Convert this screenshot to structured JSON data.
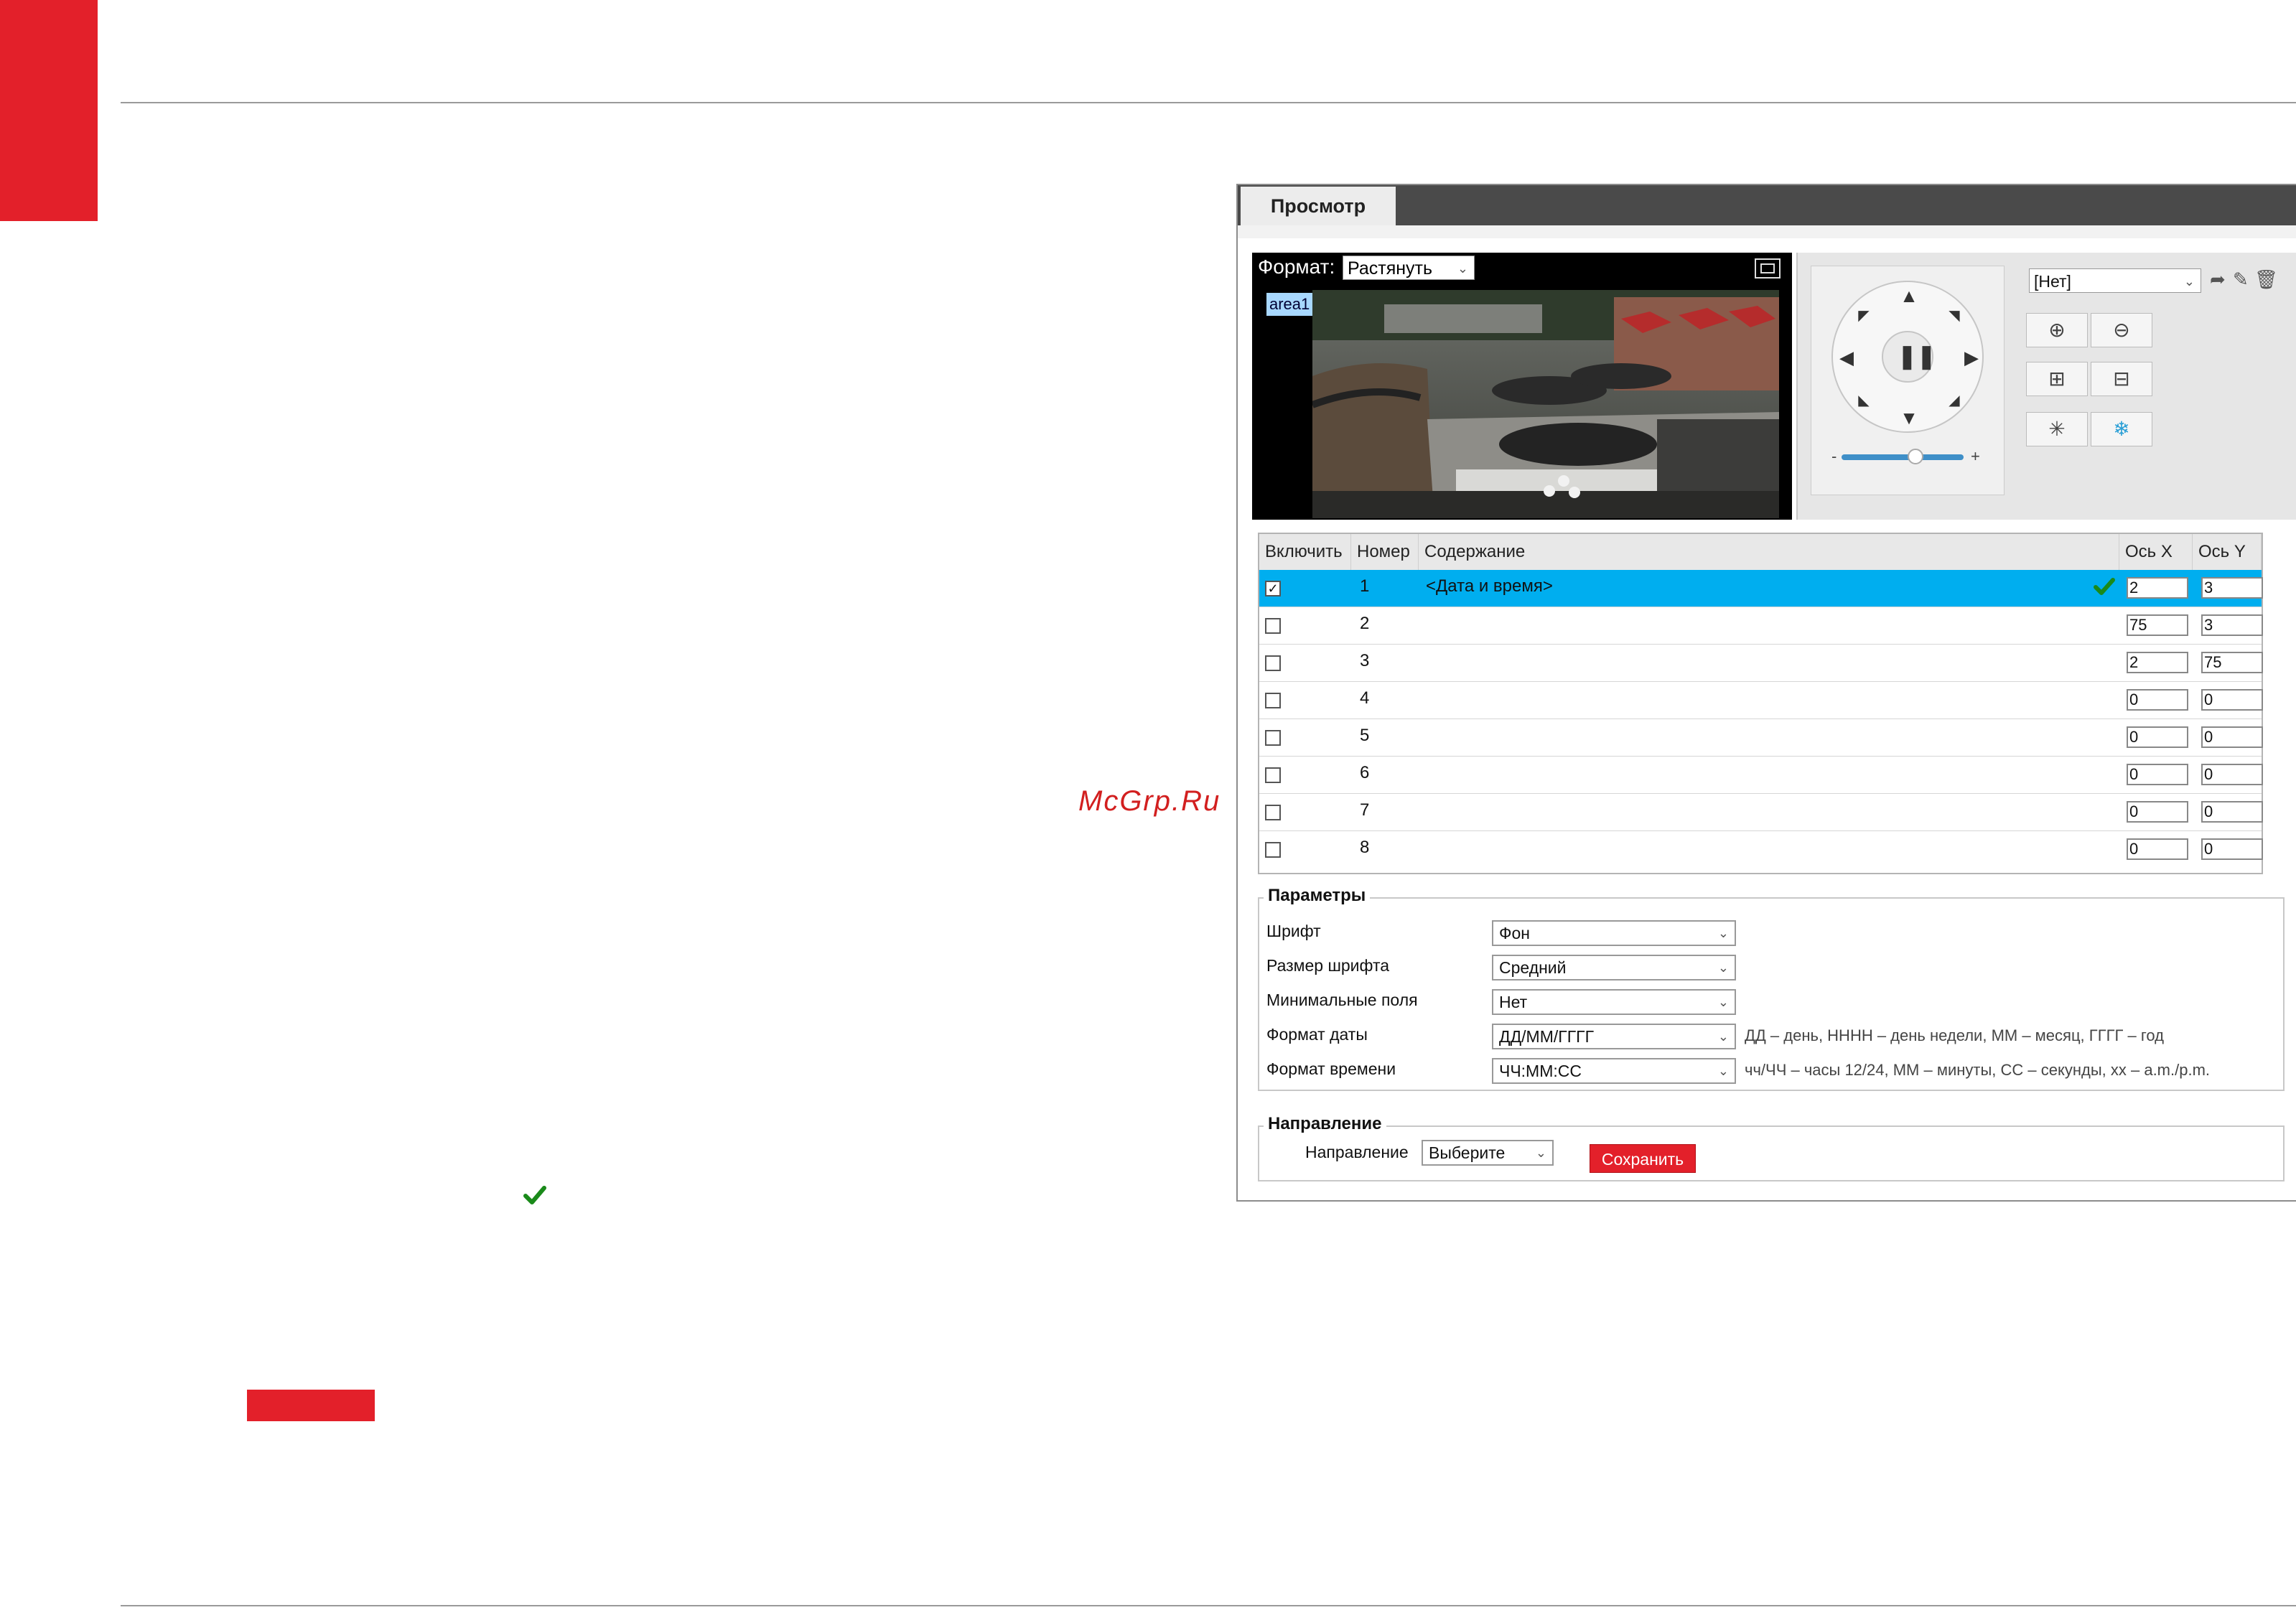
{
  "watermark": "McGrp.Ru",
  "window": {
    "tab_label": "Просмотр"
  },
  "video": {
    "format_label": "Формат:",
    "format_value": "Растянуть",
    "area_tag": "area1"
  },
  "ptz": {
    "preset_value": "[Нет]",
    "slider_minus": "-",
    "slider_plus": "+"
  },
  "overlay_table": {
    "columns": [
      "Включить",
      "Номер",
      "Содержание",
      "Ось X",
      "Ось Y"
    ],
    "rows": [
      {
        "enabled": true,
        "number": "1",
        "content": "<Дата и время>",
        "x": "2",
        "y": "3"
      },
      {
        "enabled": false,
        "number": "2",
        "content": "",
        "x": "75",
        "y": "3"
      },
      {
        "enabled": false,
        "number": "3",
        "content": "",
        "x": "2",
        "y": "75"
      },
      {
        "enabled": false,
        "number": "4",
        "content": "",
        "x": "0",
        "y": "0"
      },
      {
        "enabled": false,
        "number": "5",
        "content": "",
        "x": "0",
        "y": "0"
      },
      {
        "enabled": false,
        "number": "6",
        "content": "",
        "x": "0",
        "y": "0"
      },
      {
        "enabled": false,
        "number": "7",
        "content": "",
        "x": "0",
        "y": "0"
      },
      {
        "enabled": false,
        "number": "8",
        "content": "",
        "x": "0",
        "y": "0"
      }
    ]
  },
  "params": {
    "legend": "Параметры",
    "font_label": "Шрифт",
    "font_value": "Фон",
    "size_label": "Размер шрифта",
    "size_value": "Средний",
    "margin_label": "Минимальные поля",
    "margin_value": "Нет",
    "date_label": "Формат даты",
    "date_value": "ДД/ММ/ГГГГ",
    "date_hint": "ДД – день, НННН – день недели, ММ – месяц, ГГГГ – год",
    "time_label": "Формат времени",
    "time_value": "ЧЧ:ММ:СС",
    "time_hint": "чч/ЧЧ – часы 12/24, ММ – минуты, СС – секунды, хх – a.m./p.m."
  },
  "direction": {
    "legend": "Направление",
    "label": "Направление",
    "value": "Выберите",
    "save_label": "Сохранить"
  },
  "colors": {
    "brand_red": "#e3202a",
    "selected_row": "#00aeef",
    "check_green": "#1a8a1a"
  }
}
